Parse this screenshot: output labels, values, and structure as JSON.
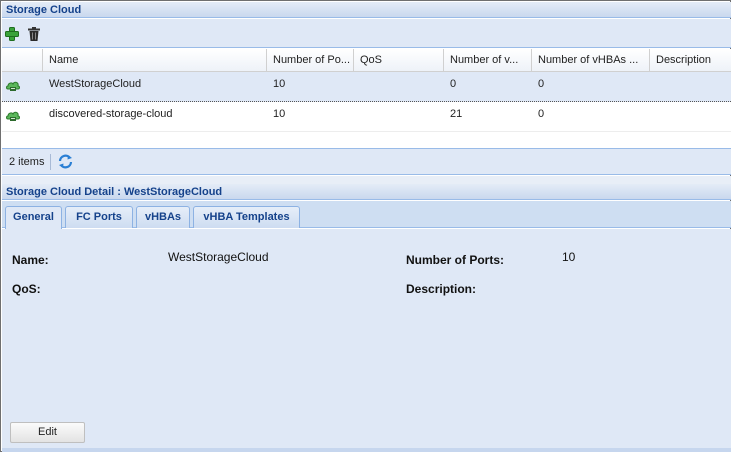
{
  "storage_cloud": {
    "title": "Storage Cloud",
    "toolbar": {
      "add_icon": "add-icon",
      "delete_icon": "trash-icon"
    },
    "columns": [
      "",
      "Name",
      "Number of Po...",
      "QoS",
      "Number of v...",
      "Number of vHBAs ...",
      "Description"
    ],
    "rows": [
      {
        "icon": "storage-cloud-icon",
        "name": "WestStorageCloud",
        "ports": "10",
        "qos": "",
        "vnum": "0",
        "vhbas": "0",
        "description": ""
      },
      {
        "icon": "storage-cloud-icon",
        "name": "discovered-storage-cloud",
        "ports": "10",
        "qos": "",
        "vnum": "21",
        "vhbas": "0",
        "description": ""
      }
    ],
    "paging": {
      "count": "2 items",
      "refresh_icon": "refresh-icon"
    }
  },
  "detail": {
    "title": "Storage Cloud Detail : WestStorageCloud",
    "tabs": [
      "General",
      "FC Ports",
      "vHBAs",
      "vHBA Templates"
    ],
    "active_tab": "General",
    "fields": {
      "name_label": "Name:",
      "name_value": "WestStorageCloud",
      "ports_label": "Number of Ports:",
      "ports_value": "10",
      "qos_label": "QoS:",
      "qos_value": "",
      "description_label": "Description:",
      "description_value": ""
    },
    "edit_label": "Edit"
  },
  "colors": {
    "header_text": "#15428b",
    "panel_bg": "#dfe8f6",
    "selected_row": "#dfe8f6",
    "border": "#99bbe8"
  }
}
